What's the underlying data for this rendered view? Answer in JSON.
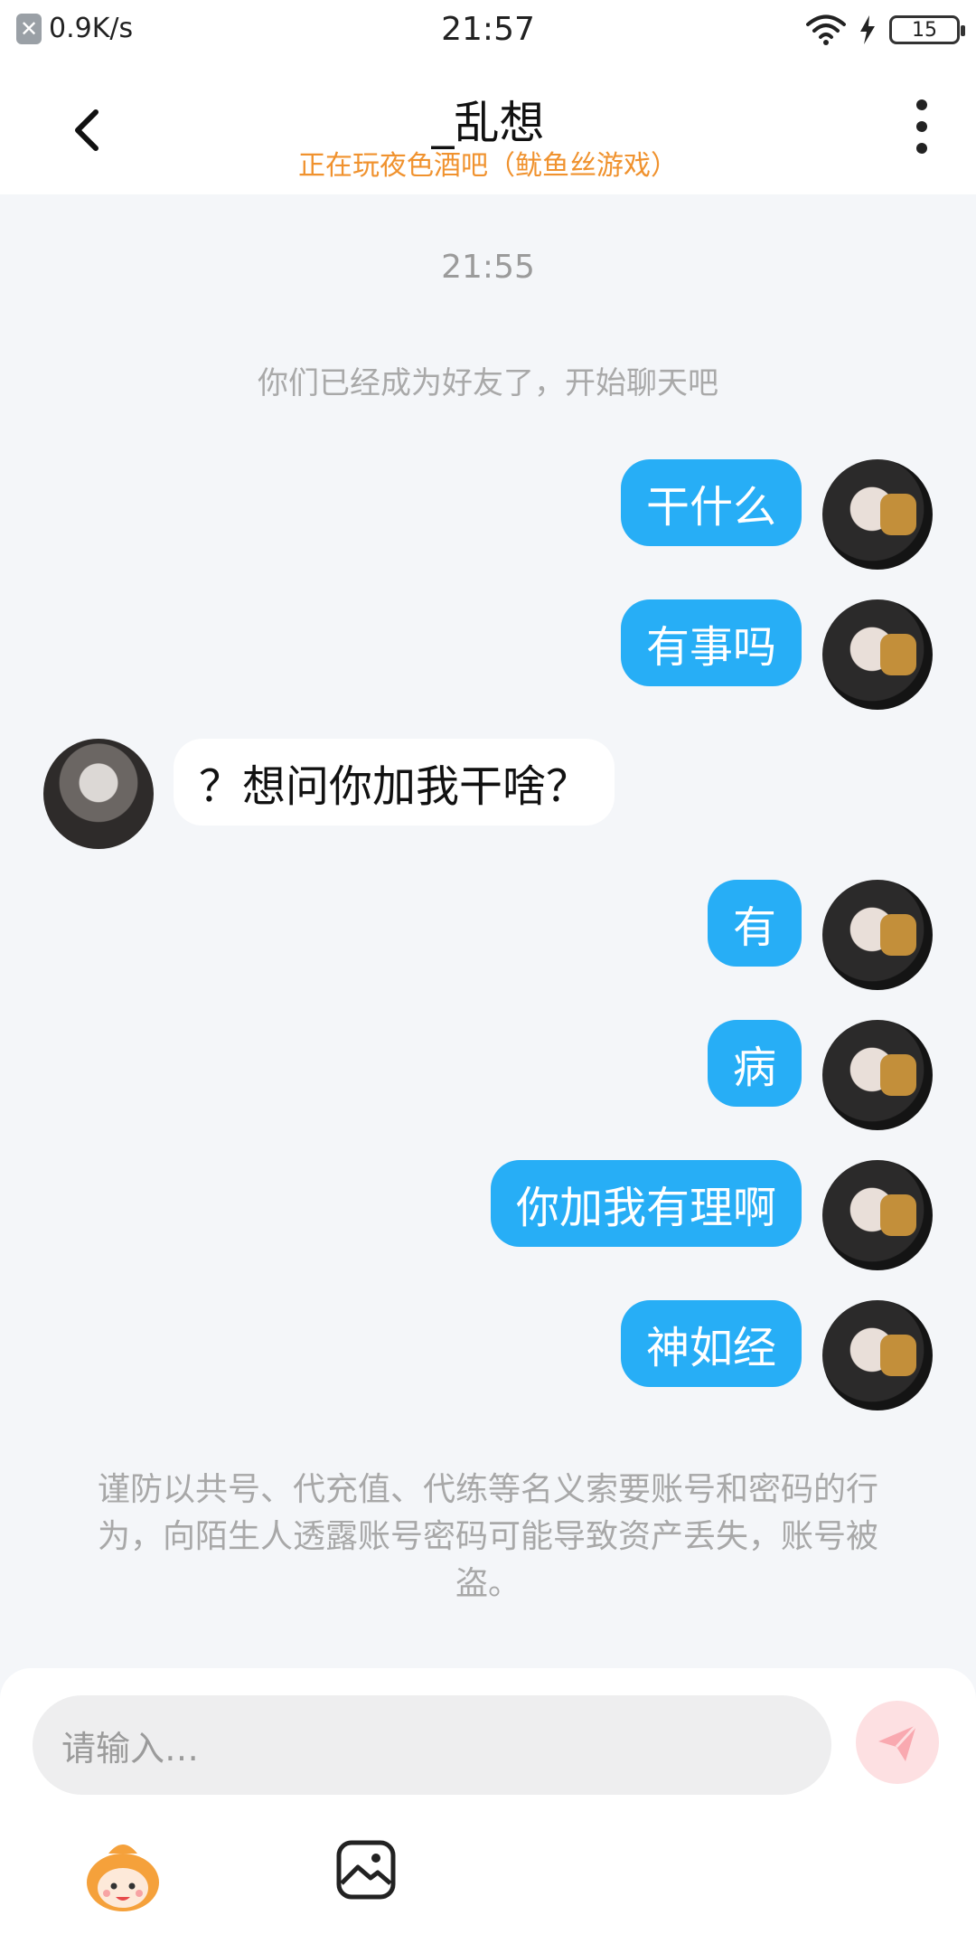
{
  "status_bar": {
    "network_speed": "0.9K/s",
    "time": "21:57",
    "battery": "15",
    "icons": [
      "close-box-icon",
      "wifi-icon",
      "charging-bolt-icon",
      "battery-icon"
    ]
  },
  "header": {
    "back_icon": "chevron-left-icon",
    "title": "_乱想",
    "subtitle": "正在玩夜色酒吧（鱿鱼丝游戏）",
    "more_icon": "more-vertical-icon"
  },
  "chat": {
    "timestamp": "21:55",
    "system_note": "你们已经成为好友了，开始聊天吧",
    "messages": [
      {
        "side": "mine",
        "text": "干什么"
      },
      {
        "side": "mine",
        "text": "有事吗"
      },
      {
        "side": "theirs",
        "text": "？想问你加我干啥？"
      },
      {
        "side": "mine",
        "text": "有"
      },
      {
        "side": "mine",
        "text": "病"
      },
      {
        "side": "mine",
        "text": "你加我有理啊"
      },
      {
        "side": "mine",
        "text": "神如经"
      }
    ],
    "warning": "谨防以共号、代充值、代练等名义索要账号和密码的行为，向陌生人透露账号密码可能导致资产丢失，账号被盗。"
  },
  "composer": {
    "placeholder": "请输入…",
    "send_icon": "paper-plane-icon",
    "tools": [
      "mascot-emoji-icon",
      "image-icon"
    ]
  },
  "colors": {
    "my_bubble": "#27aef6",
    "their_bubble": "#ffffff",
    "subtitle": "#f0922e",
    "background": "#f4f6f9",
    "send_disabled": "#fde0e2"
  }
}
